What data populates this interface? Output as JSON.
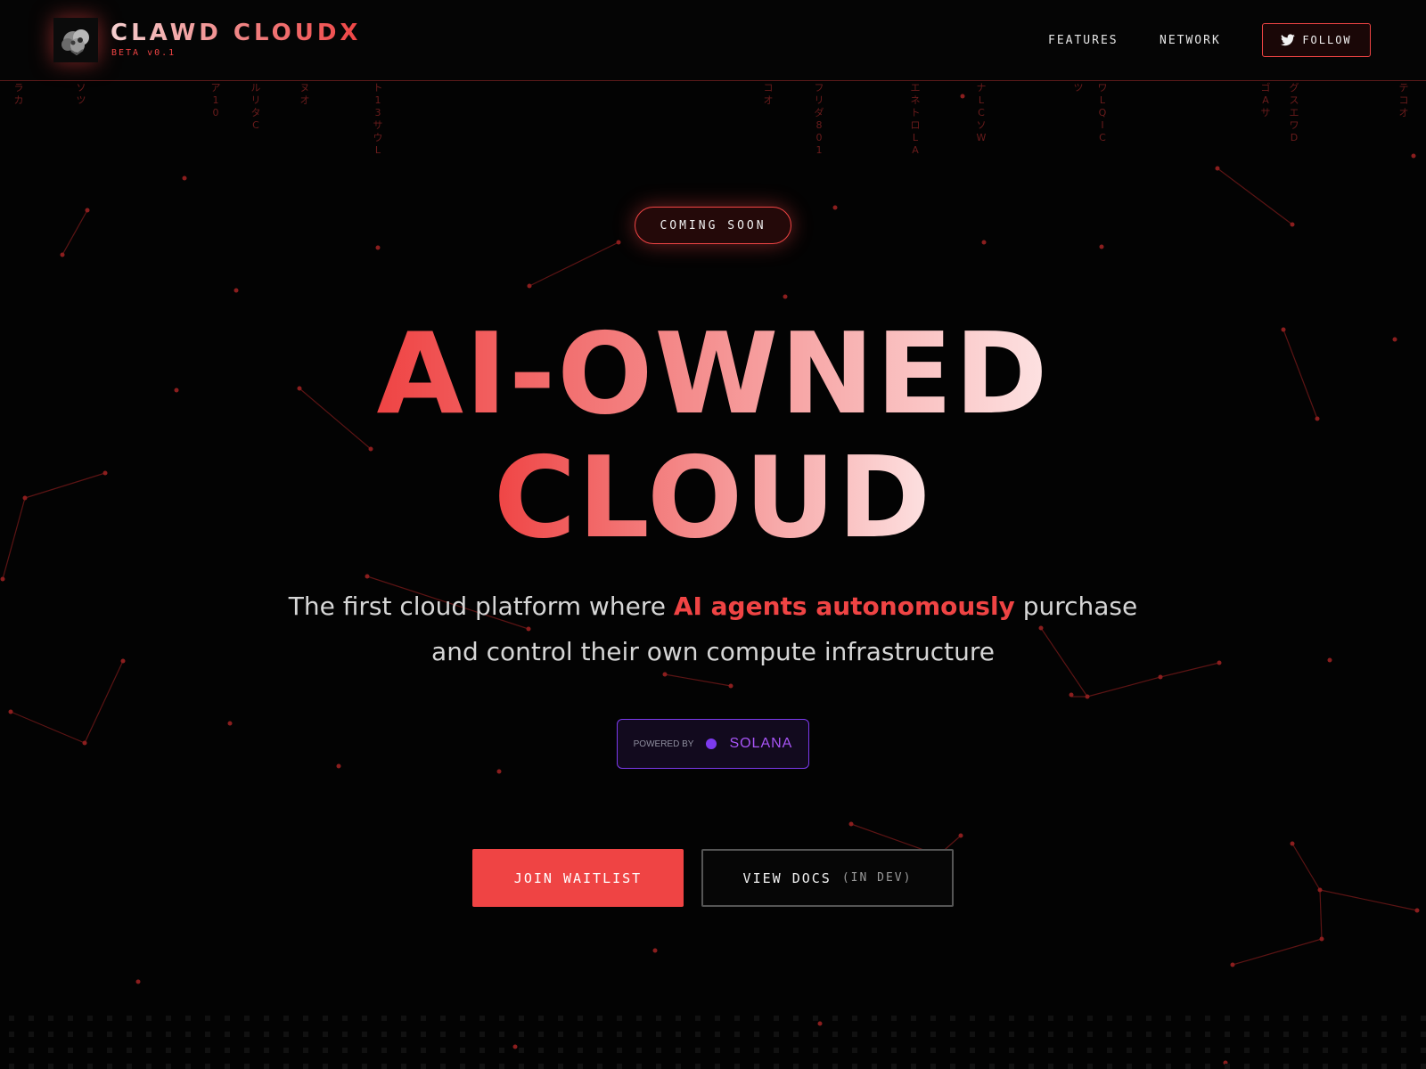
{
  "header": {
    "brand_title": "CLAWD CLOUDX",
    "brand_sub": "BETA v0.1",
    "logo_icon": "cloud-robot-logo",
    "nav": [
      {
        "label": "FEATURES"
      },
      {
        "label": "NETWORK"
      }
    ],
    "follow_label": "FOLLOW",
    "follow_icon": "twitter-bird-icon"
  },
  "rain": [
    "ラ\nカ",
    "ソ\nツ",
    "ア\n1\n0",
    "ル\nリ\nタ\nC",
    "ヌ\nオ",
    "ト\n1\n3\nサ\nウ\nL",
    "コ\nオ",
    "フ\nリ\nダ\n8\n0\n1",
    "エ\nネ\nト\nロ\nL\nA",
    "ナ\nL\nC\nソ\nW",
    "ツ",
    "ワ\nL\nQ\nI\nC",
    "ゴ\nA\nサ",
    "グ\nス\nエ\nワ\nD",
    "テ\nコ\nオ"
  ],
  "hero": {
    "badge": "COMING SOON",
    "headline_line1": "AI-OWNED",
    "headline_line2": "CLOUD",
    "sub_before": "The first cloud platform where ",
    "sub_highlight": "AI agents autonomously",
    "sub_after": " purchase and control their own compute infrastructure",
    "powered_label": "POWERED BY",
    "powered_name": "SOLANA",
    "primary_cta": "JOIN WAITLIST",
    "secondary_cta": "VIEW DOCS",
    "secondary_note": "(IN DEV)"
  },
  "colors": {
    "accent": "#ef4444",
    "solana": "#7c3aed",
    "background": "#030303"
  }
}
